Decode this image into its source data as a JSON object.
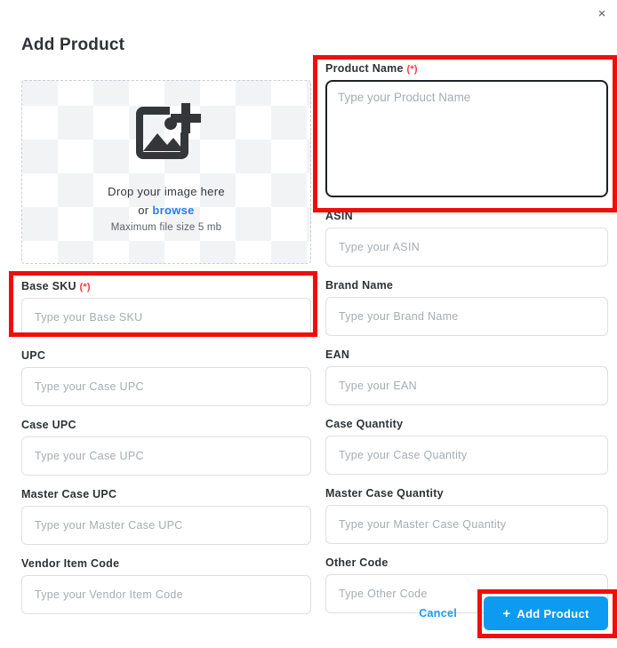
{
  "dialog": {
    "title": "Add Product",
    "close_icon": "close-icon",
    "close_label": "×"
  },
  "dropzone": {
    "icon": "add-image-icon",
    "title": "Drop your image here",
    "or_text": "or",
    "browse_label": "browse",
    "max_size_text": "Maximum file size 5 mb"
  },
  "left_fields": [
    {
      "name": "base-sku",
      "label": "Base SKU",
      "required": true,
      "required_mark": "(*)",
      "placeholder": "Type your Base SKU",
      "value": ""
    },
    {
      "name": "upc",
      "label": "UPC",
      "required": false,
      "required_mark": "",
      "placeholder": "Type your Case UPC",
      "value": ""
    },
    {
      "name": "case-upc",
      "label": "Case UPC",
      "required": false,
      "required_mark": "",
      "placeholder": "Type your Case UPC",
      "value": ""
    },
    {
      "name": "master-case-upc",
      "label": "Master Case UPC",
      "required": false,
      "required_mark": "",
      "placeholder": "Type your Master Case UPC",
      "value": ""
    },
    {
      "name": "vendor-item-code",
      "label": "Vendor Item Code",
      "required": false,
      "required_mark": "",
      "placeholder": "Type your Vendor Item Code",
      "value": ""
    }
  ],
  "product_name": {
    "name": "product-name",
    "label": "Product Name",
    "required": true,
    "required_mark": "(*)",
    "placeholder": "Type your Product Name",
    "value": ""
  },
  "right_fields": [
    {
      "name": "asin",
      "label": "ASIN",
      "required": false,
      "required_mark": "",
      "placeholder": "Type your ASIN",
      "value": ""
    },
    {
      "name": "brand-name",
      "label": "Brand Name",
      "required": false,
      "required_mark": "",
      "placeholder": "Type your Brand Name",
      "value": ""
    },
    {
      "name": "ean",
      "label": "EAN",
      "required": false,
      "required_mark": "",
      "placeholder": "Type your EAN",
      "value": ""
    },
    {
      "name": "case-quantity",
      "label": "Case Quantity",
      "required": false,
      "required_mark": "",
      "placeholder": "Type your Case Quantity",
      "value": ""
    },
    {
      "name": "master-case-quantity",
      "label": "Master Case Quantity",
      "required": false,
      "required_mark": "",
      "placeholder": "Type your Master Case Quantity",
      "value": ""
    },
    {
      "name": "other-code",
      "label": "Other Code",
      "required": false,
      "required_mark": "",
      "placeholder": "Type Other Code",
      "value": ""
    }
  ],
  "footer": {
    "cancel_label": "Cancel",
    "add_plus": "+",
    "add_label": "Add Product"
  },
  "colors": {
    "accent_blue": "#0d9bf2",
    "link_blue": "#2b7cf5",
    "required_red": "#f03c3c",
    "highlight_red": "#f20d0d",
    "label_text": "#2e3235",
    "placeholder_text": "#a7acb1",
    "input_border": "#dcdfe2",
    "focus_border": "#1d2023"
  },
  "highlights": [
    {
      "name": "product-name-highlight"
    },
    {
      "name": "base-sku-highlight"
    },
    {
      "name": "add-product-highlight"
    }
  ]
}
